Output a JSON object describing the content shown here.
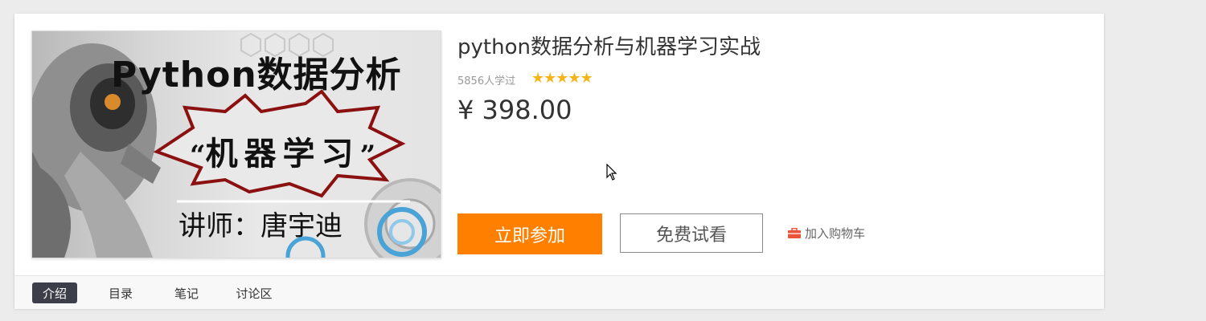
{
  "course": {
    "thumbnail": {
      "title": "Python数据分析",
      "subtitle": "机器学习",
      "quote_open": "“",
      "quote_close": "”",
      "teacher": "讲师：唐宇迪"
    },
    "title": "python数据分析与机器学习实战",
    "learners": "5856人学过",
    "rating_stars": 5,
    "price": "¥ 398.00"
  },
  "actions": {
    "join_label": "立即参加",
    "trial_label": "免费试看",
    "cart_label": "加入购物车",
    "cart_icon": "briefcase-icon"
  },
  "tabs": [
    {
      "label": "介绍",
      "active": true
    },
    {
      "label": "目录",
      "active": false
    },
    {
      "label": "笔记",
      "active": false
    },
    {
      "label": "讨论区",
      "active": false
    }
  ],
  "colors": {
    "accent": "#ff8000",
    "star": "#f5b418",
    "active_tab": "#3c3f4a",
    "cart_icon": "#e8553b"
  }
}
